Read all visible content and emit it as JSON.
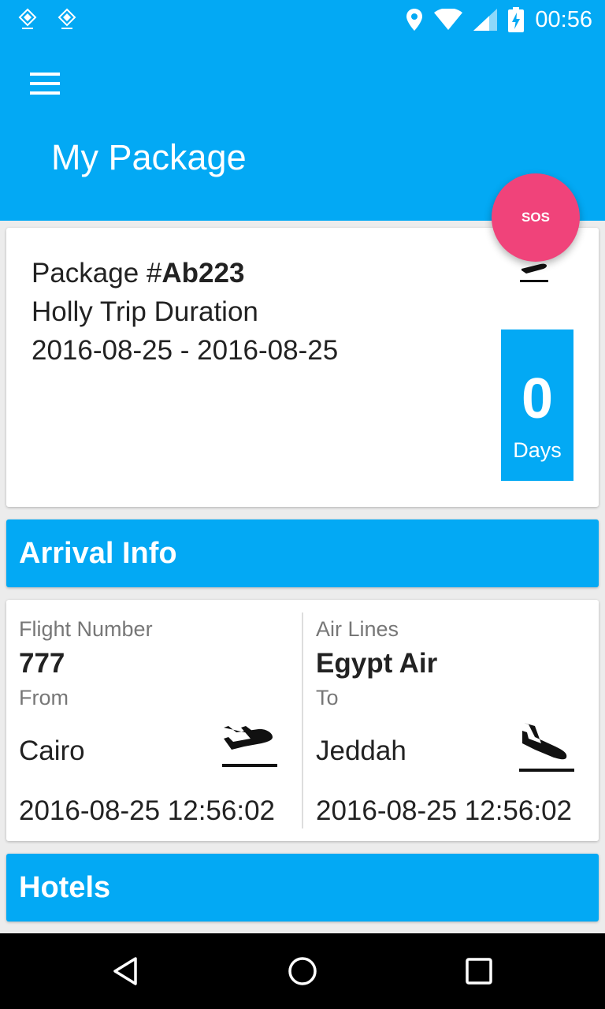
{
  "status_bar": {
    "time": "00:56",
    "icons": [
      "app-notification-icon",
      "app-notification-icon",
      "location-icon",
      "wifi-icon",
      "signal-icon",
      "battery-charging-icon"
    ]
  },
  "app_bar": {
    "menu_icon": "hamburger-menu-icon",
    "title": "My Package"
  },
  "sos_button": {
    "label": "SOS",
    "color": "#f0437a"
  },
  "package": {
    "prefix": "Package #",
    "id": "Ab223",
    "duration_label": "Holly Trip Duration",
    "date_range": "2016-08-25 - 2016-08-25",
    "icon": "flight-takeoff-icon",
    "days_count": "0",
    "days_label": "Days"
  },
  "arrival": {
    "header": "Arrival Info",
    "flight_number_label": "Flight Number",
    "flight_number": "777",
    "airlines_label": "Air Lines",
    "airline": "Egypt Air",
    "from_label": "From",
    "from_city": "Cairo",
    "from_datetime": "2016-08-25 12:56:02",
    "from_icon": "flight-takeoff-icon",
    "to_label": "To",
    "to_city": "Jeddah",
    "to_datetime": "2016-08-25 12:56:02",
    "to_icon": "flight-land-icon"
  },
  "hotels": {
    "header": "Hotels"
  },
  "nav_bar": {
    "icons": [
      "back-icon",
      "home-icon",
      "recents-icon"
    ]
  },
  "colors": {
    "primary": "#03a9f4",
    "accent": "#f0437a",
    "background": "#ececec"
  }
}
